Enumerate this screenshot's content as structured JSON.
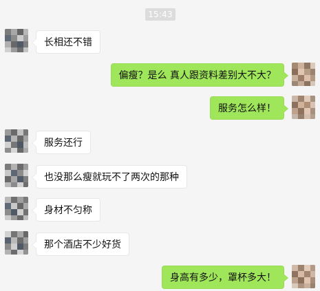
{
  "chat": {
    "timestamp": "15:43",
    "messages": [
      {
        "sender": "left",
        "text": "长相还不错"
      },
      {
        "sender": "right",
        "text": "偏瘦？是么 真人跟资料差别大不大？"
      },
      {
        "sender": "right",
        "text": "服务怎么样！"
      },
      {
        "sender": "left",
        "text": "服务还行"
      },
      {
        "sender": "left",
        "text": "也没那么瘦就玩不了两次的那种"
      },
      {
        "sender": "left",
        "text": "身材不匀称"
      },
      {
        "sender": "left",
        "text": "那个酒店不少好货"
      },
      {
        "sender": "right",
        "text": "身高有多少，罩杯多大！"
      }
    ]
  },
  "colors": {
    "background": "#f5f5f5",
    "timestamp_bg": "#dcdcdc",
    "sent_bubble": "#9fe65a",
    "received_bubble": "#ffffff"
  }
}
